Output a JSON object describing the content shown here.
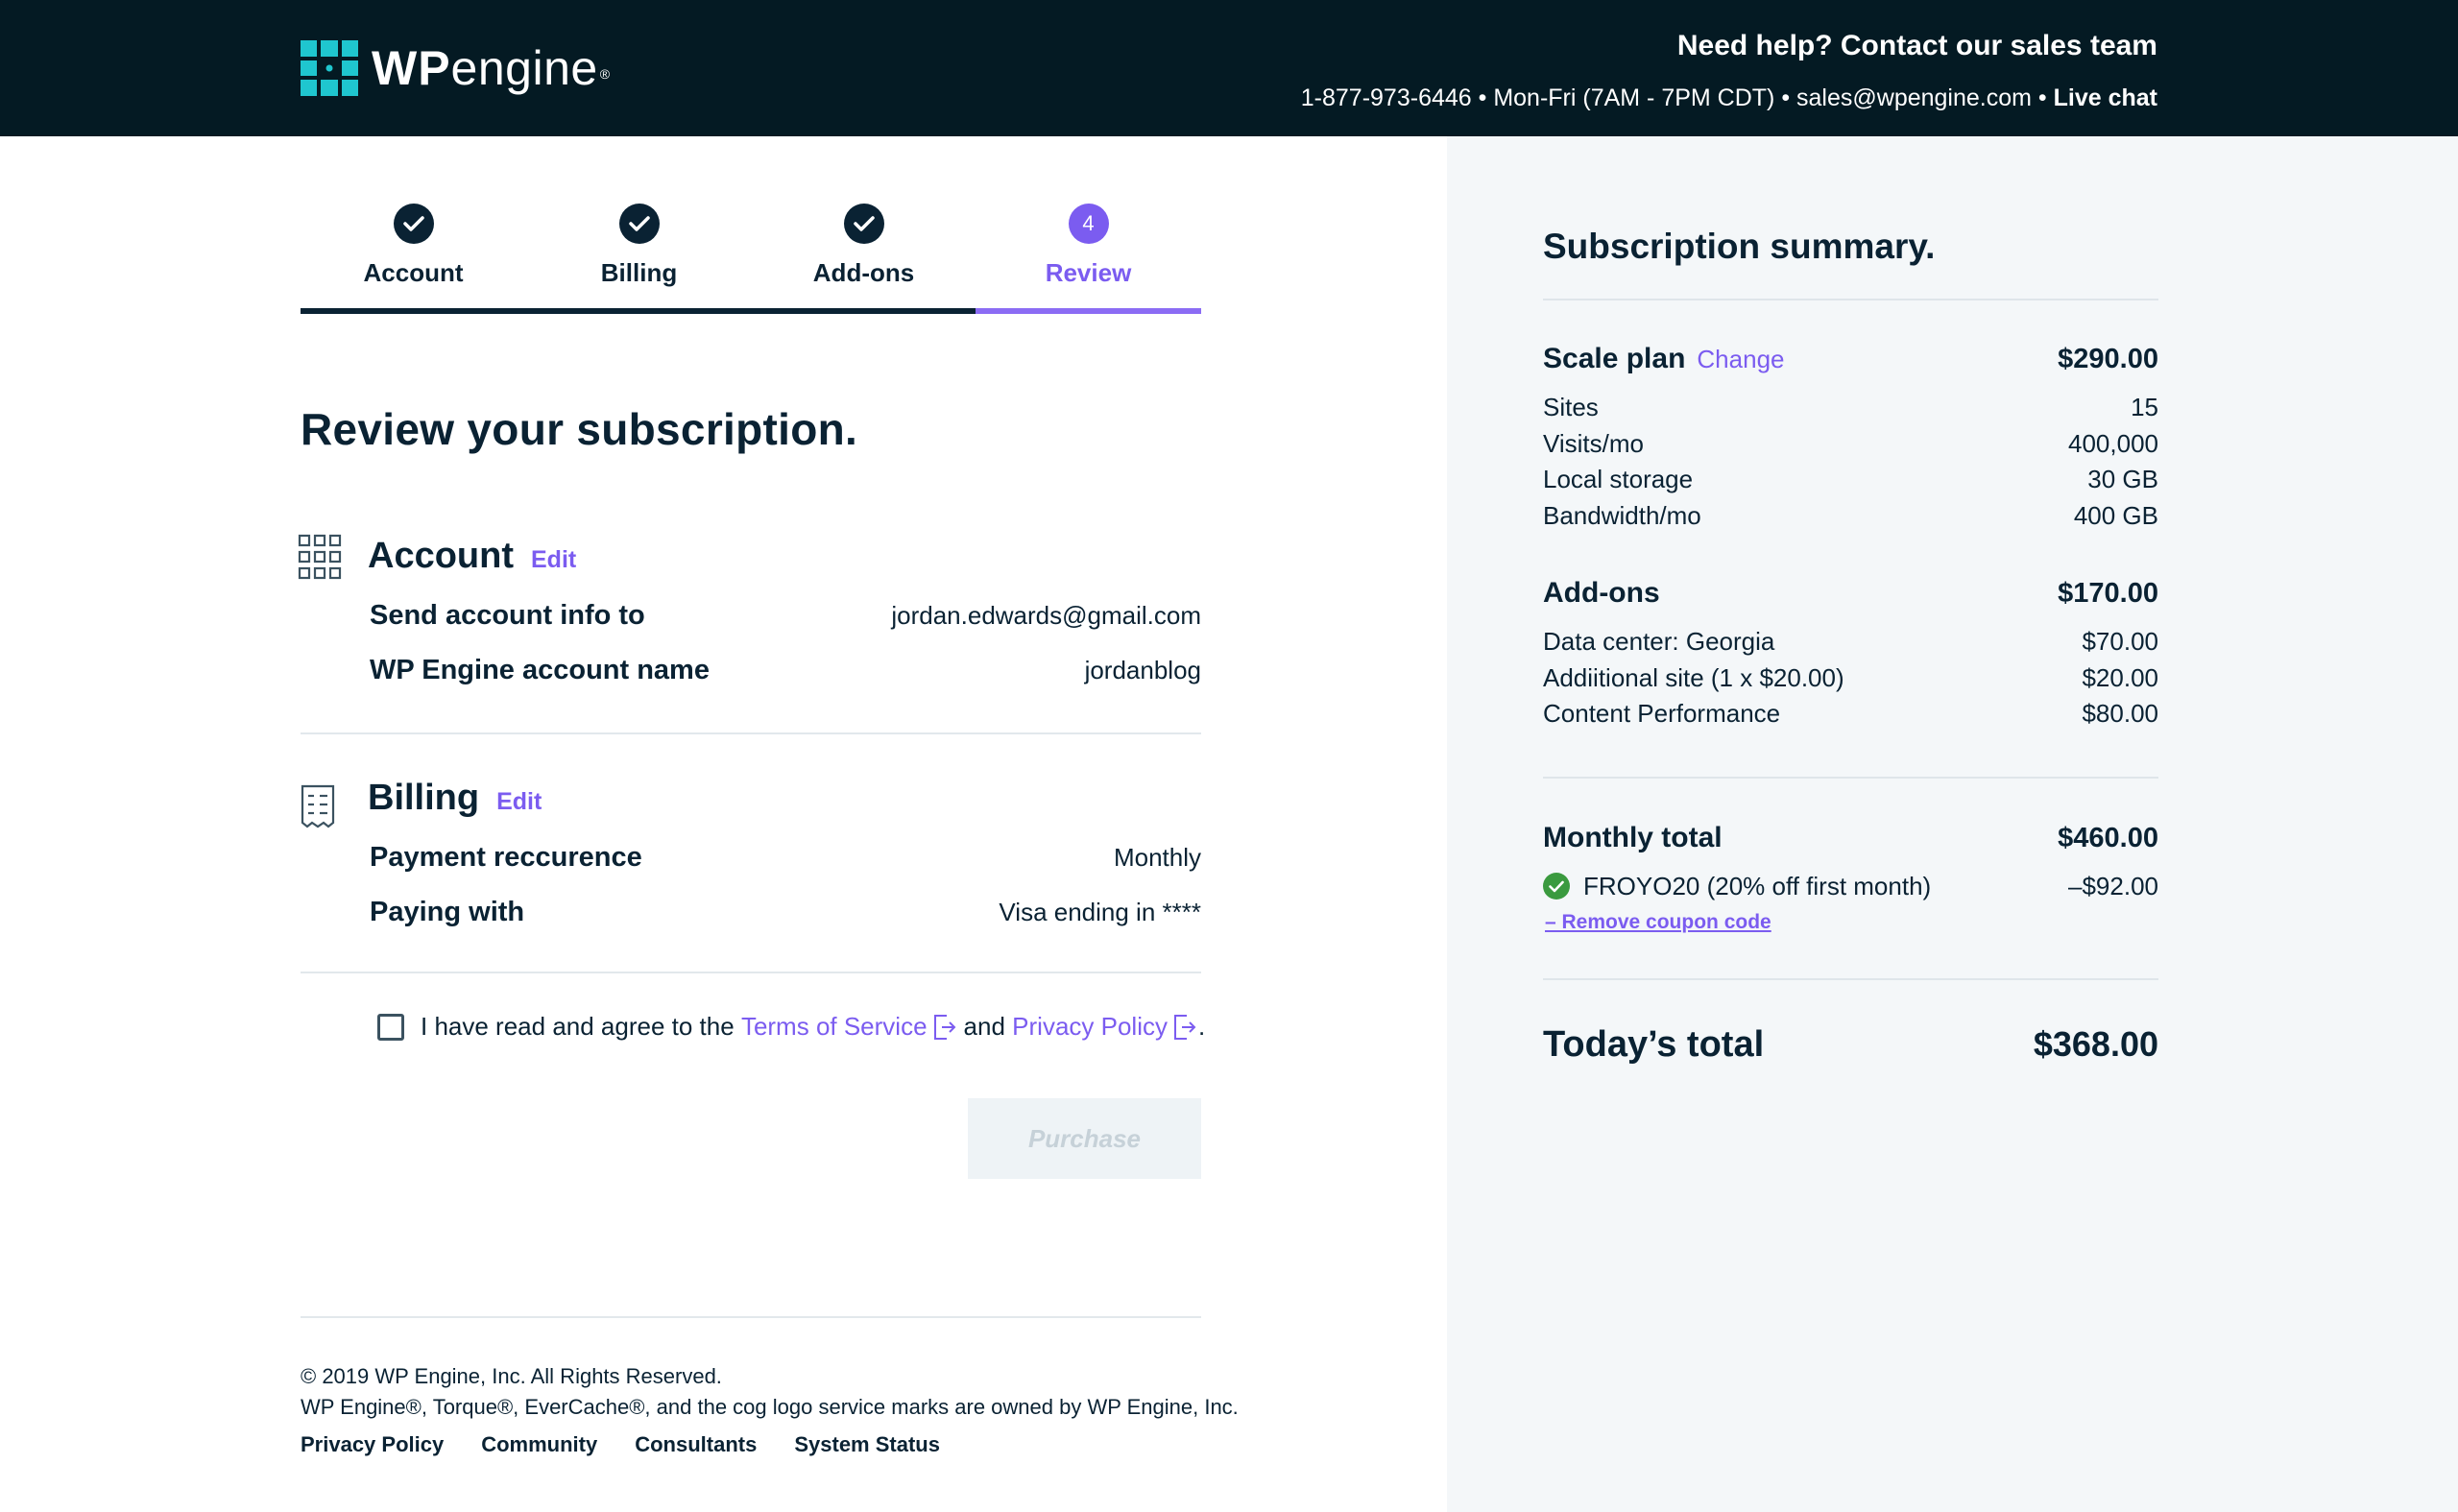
{
  "header": {
    "logo_text_bold": "WP",
    "logo_text_light": "engine",
    "logo_reg": "®",
    "help_title": "Need help? Contact our sales team",
    "help_contact": "1-877-973-6446 • Mon-Fri (7AM - 7PM CDT) • sales@wpengine.com • ",
    "live_chat": "Live chat"
  },
  "stepper": {
    "steps": [
      {
        "label": "Account",
        "state": "done"
      },
      {
        "label": "Billing",
        "state": "done"
      },
      {
        "label": "Add-ons",
        "state": "done"
      },
      {
        "label": "Review",
        "state": "current",
        "number": "4"
      }
    ]
  },
  "page_title": "Review your subscription.",
  "account": {
    "title": "Account",
    "edit": "Edit",
    "rows": [
      {
        "label": "Send account info to",
        "value": "jordan.edwards@gmail.com"
      },
      {
        "label": "WP Engine account name",
        "value": "jordanblog"
      }
    ]
  },
  "billing": {
    "title": "Billing",
    "edit": "Edit",
    "rows": [
      {
        "label": "Payment reccurence",
        "value": "Monthly"
      },
      {
        "label": "Paying with",
        "value": "Visa ending in ****"
      }
    ]
  },
  "agreement": {
    "prefix": "I have read and agree to the ",
    "tos": "Terms of Service",
    "and": "and",
    "privacy": "Privacy Policy",
    "suffix": "."
  },
  "purchase_label": "Purchase",
  "footer": {
    "copyright": "© 2019 WP Engine, Inc. All Rights Reserved.",
    "trademark": "WP Engine®, Torque®, EverCache®, and the cog logo service marks are owned by WP Engine, Inc.",
    "links": [
      "Privacy Policy",
      "Community",
      "Consultants",
      "System Status"
    ]
  },
  "summary": {
    "title": "Subscription summary.",
    "plan": {
      "label": "Scale plan",
      "change": "Change",
      "price": "$290.00"
    },
    "plan_rows": [
      {
        "label": "Sites",
        "value": "15"
      },
      {
        "label": "Visits/mo",
        "value": "400,000"
      },
      {
        "label": "Local storage",
        "value": "30 GB"
      },
      {
        "label": "Bandwidth/mo",
        "value": "400 GB"
      }
    ],
    "addons": {
      "label": "Add-ons",
      "price": "$170.00"
    },
    "addon_rows": [
      {
        "label": "Data center: Georgia",
        "value": "$70.00"
      },
      {
        "label": "Addiitional site (1 x $20.00)",
        "value": "$20.00"
      },
      {
        "label": "Content Performance",
        "value": "$80.00"
      }
    ],
    "monthly": {
      "label": "Monthly total",
      "price": "$460.00"
    },
    "coupon": {
      "label": "FROYO20 (20% off first month)",
      "value": "–$92.00",
      "remove": "– Remove coupon code"
    },
    "today": {
      "label": "Today’s total",
      "price": "$368.00"
    }
  },
  "colors": {
    "header_bg": "#041a23",
    "accent": "#7b5cf0",
    "text": "#0a2233",
    "logo_teal": "#1fc6cf",
    "success": "#3a9a3f",
    "panel_bg": "#f4f7f9"
  }
}
